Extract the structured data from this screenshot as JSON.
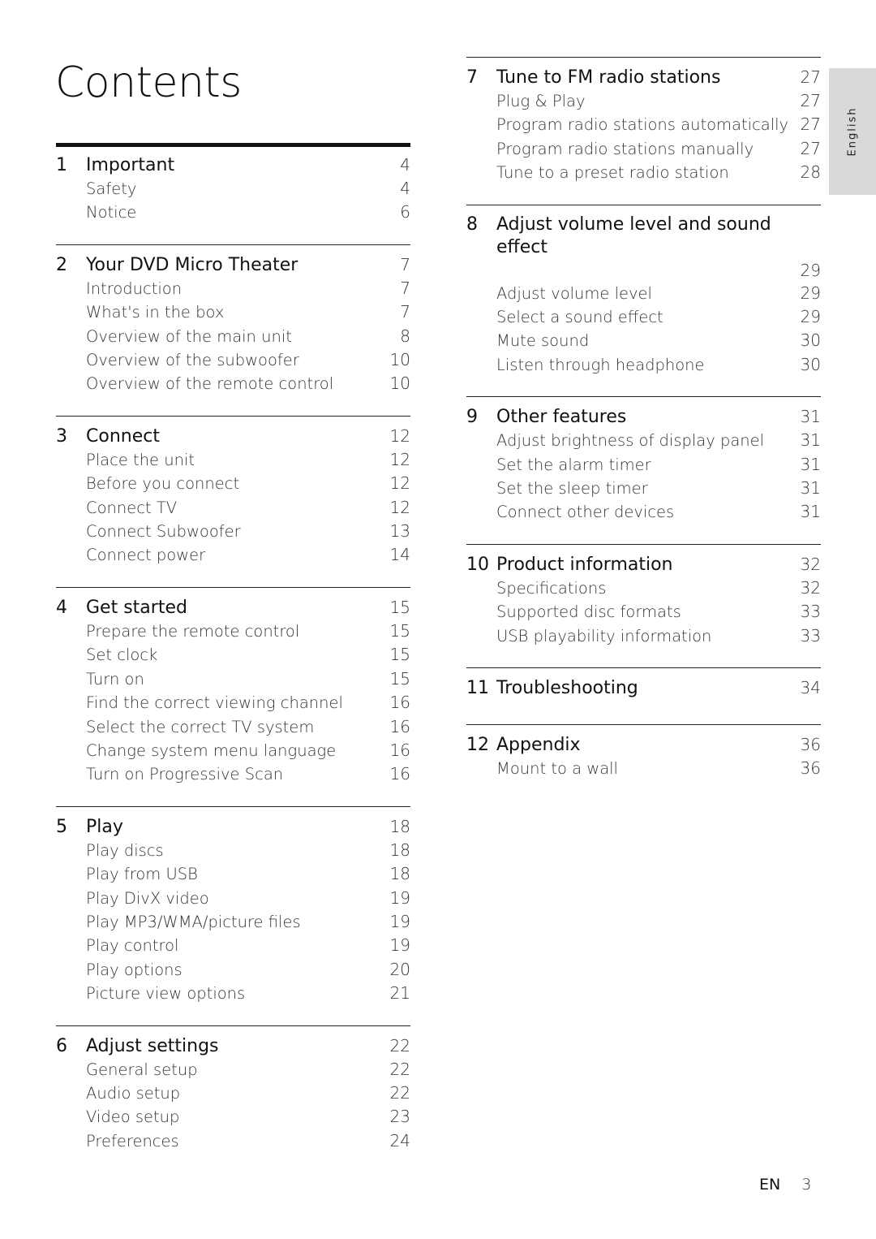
{
  "title": "Contents",
  "language_tab": "English",
  "footer": {
    "lang": "EN",
    "page": "3"
  },
  "left_column": [
    {
      "num": "1",
      "title": "Important",
      "page": "4",
      "items": [
        {
          "label": "Safety",
          "page": "4"
        },
        {
          "label": "Notice",
          "page": "6"
        }
      ]
    },
    {
      "num": "2",
      "title": "Your DVD Micro Theater",
      "page": "7",
      "items": [
        {
          "label": "Introduction",
          "page": "7"
        },
        {
          "label": "What's in the box",
          "page": "7"
        },
        {
          "label": "Overview of the main unit",
          "page": "8"
        },
        {
          "label": "Overview of the subwoofer",
          "page": "10"
        },
        {
          "label": "Overview of the remote control",
          "page": "10"
        }
      ]
    },
    {
      "num": "3",
      "title": "Connect",
      "page": "12",
      "items": [
        {
          "label": "Place the unit",
          "page": "12"
        },
        {
          "label": "Before you connect",
          "page": "12"
        },
        {
          "label": "Connect TV",
          "page": "12"
        },
        {
          "label": "Connect Subwoofer",
          "page": "13"
        },
        {
          "label": "Connect power",
          "page": "14"
        }
      ]
    },
    {
      "num": "4",
      "title": "Get started",
      "page": "15",
      "items": [
        {
          "label": "Prepare the remote control",
          "page": "15"
        },
        {
          "label": "Set clock",
          "page": "15"
        },
        {
          "label": "Turn on",
          "page": "15"
        },
        {
          "label": "Find the correct viewing channel",
          "page": "16"
        },
        {
          "label": "Select the correct TV system",
          "page": "16"
        },
        {
          "label": "Change system menu language",
          "page": "16"
        },
        {
          "label": "Turn on Progressive Scan",
          "page": "16"
        }
      ]
    },
    {
      "num": "5",
      "title": "Play",
      "page": "18",
      "items": [
        {
          "label": "Play discs",
          "page": "18"
        },
        {
          "label": "Play from USB",
          "page": "18"
        },
        {
          "label": "Play DivX video",
          "page": "19"
        },
        {
          "label": "Play MP3/WMA/picture files",
          "page": "19"
        },
        {
          "label": "Play control",
          "page": "19"
        },
        {
          "label": "Play options",
          "page": "20"
        },
        {
          "label": "Picture view options",
          "page": "21"
        }
      ]
    },
    {
      "num": "6",
      "title": "Adjust settings",
      "page": "22",
      "items": [
        {
          "label": "General setup",
          "page": "22"
        },
        {
          "label": "Audio setup",
          "page": "22"
        },
        {
          "label": "Video setup",
          "page": "23"
        },
        {
          "label": "Preferences",
          "page": "24"
        }
      ]
    }
  ],
  "right_column": [
    {
      "num": "7",
      "title": "Tune to FM radio stations",
      "page": "27",
      "items": [
        {
          "label": "Plug & Play",
          "page": "27"
        },
        {
          "label": "Program radio stations automatically",
          "page": "27"
        },
        {
          "label": "Program radio stations manually",
          "page": "27"
        },
        {
          "label": "Tune to a preset radio station",
          "page": "28"
        }
      ]
    },
    {
      "num": "8",
      "title": "Adjust volume level and sound effect",
      "page": "29",
      "wrap_page": true,
      "items": [
        {
          "label": "Adjust volume level",
          "page": "29"
        },
        {
          "label": "Select a sound effect",
          "page": "29"
        },
        {
          "label": "Mute sound",
          "page": "30"
        },
        {
          "label": "Listen through headphone",
          "page": "30"
        }
      ]
    },
    {
      "num": "9",
      "title": "Other features",
      "page": "31",
      "items": [
        {
          "label": "Adjust brightness of display panel",
          "page": "31"
        },
        {
          "label": "Set the alarm timer",
          "page": "31"
        },
        {
          "label": "Set the sleep timer",
          "page": "31"
        },
        {
          "label": "Connect other devices",
          "page": "31"
        }
      ]
    },
    {
      "num": "10",
      "title": "Product information",
      "page": "32",
      "items": [
        {
          "label": "Specifications",
          "page": "32"
        },
        {
          "label": "Supported disc formats",
          "page": "33"
        },
        {
          "label": "USB playability information",
          "page": "33"
        }
      ]
    },
    {
      "num": "11",
      "title": "Troubleshooting",
      "page": "34",
      "items": []
    },
    {
      "num": "12",
      "title": "Appendix",
      "page": "36",
      "items": [
        {
          "label": "Mount to a wall",
          "page": "36"
        }
      ]
    }
  ]
}
